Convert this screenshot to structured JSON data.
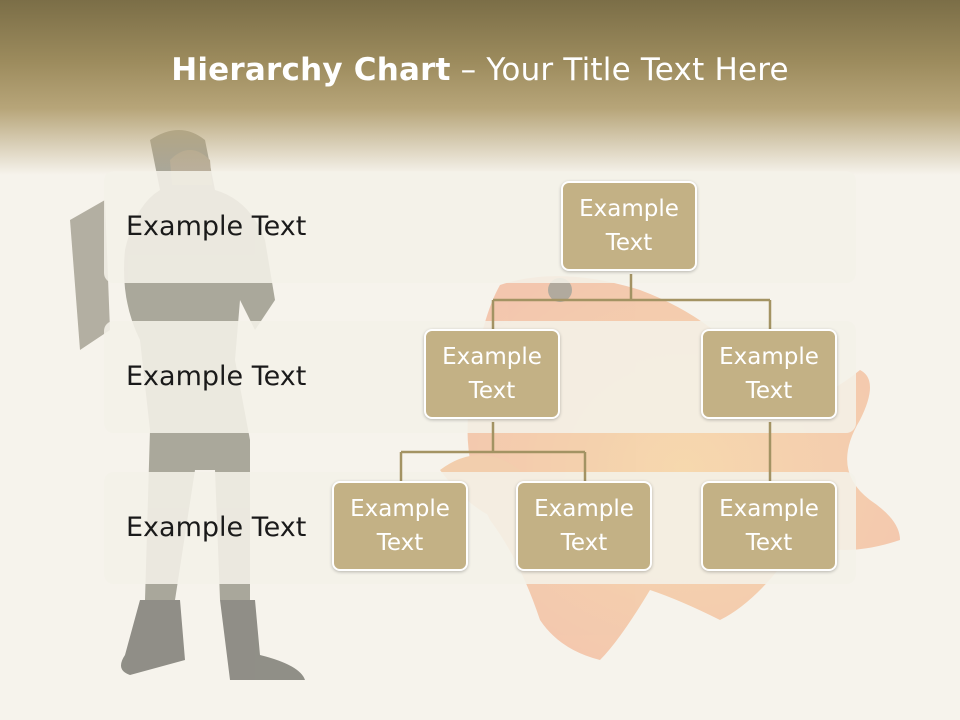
{
  "slide": {
    "title_bold": "Hierarchy Chart",
    "title_rest": " – Your Title Text Here"
  },
  "bands": [
    {
      "label": "Example Text"
    },
    {
      "label": "Example Text"
    },
    {
      "label": "Example Text"
    }
  ],
  "nodes": {
    "root": "Example Text",
    "level2_left": "Example Text",
    "level2_right": "Example Text",
    "level3_left": "Example Text",
    "level3_middle": "Example Text",
    "level3_right": "Example Text"
  },
  "colors": {
    "header": "#9c8b5d",
    "node_fill": "#c3b185",
    "connector": "#a39363",
    "band_fill": "#f4f1e8"
  }
}
